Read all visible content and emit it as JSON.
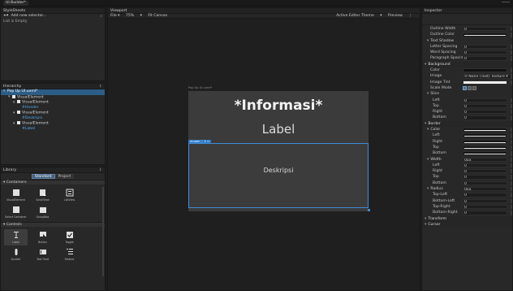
{
  "titlebar": {
    "doc_tab": "UI Builder*"
  },
  "stylesheets": {
    "title": "StyleSheets",
    "add_label": "Add new selector...",
    "empty_text": "List is Empty"
  },
  "hierarchy": {
    "title": "Hierarchy",
    "rows": [
      {
        "label": "Pop Up UI.uxml*",
        "depth": 0,
        "selected": true
      },
      {
        "label": "VisualElement",
        "depth": 1
      },
      {
        "label": "VisualElement",
        "depth": 2
      },
      {
        "label": "#Header",
        "depth": 3,
        "sub": true
      },
      {
        "label": "VisualElement",
        "depth": 2
      },
      {
        "label": "#Deskripsi",
        "depth": 3,
        "sub": true
      },
      {
        "label": "VisualElement",
        "depth": 2
      },
      {
        "label": "#Label",
        "depth": 3,
        "sub": true
      }
    ]
  },
  "library": {
    "title": "Library",
    "tabs": [
      "Standard",
      "Project"
    ],
    "active_tab": "Standard",
    "sections": [
      {
        "title": "Containers",
        "items": [
          {
            "label": "VisualElement",
            "icon": "square-icon"
          },
          {
            "label": "ScrollView",
            "icon": "scrollview-icon"
          },
          {
            "label": "ListView",
            "icon": "listview-icon"
          },
          {
            "label": "Select Container",
            "icon": "select-icon"
          },
          {
            "label": "GroupBox",
            "icon": "groupbox-icon"
          }
        ]
      },
      {
        "title": "Controls",
        "items": [
          {
            "label": "Label",
            "icon": "text-cursor-icon",
            "selected": true
          },
          {
            "label": "Button",
            "icon": "cursor-icon"
          },
          {
            "label": "Toggle",
            "icon": "checkbox-icon"
          },
          {
            "label": "Scroller",
            "icon": "scroller-icon"
          },
          {
            "label": "Text Field",
            "icon": "textfield-icon"
          },
          {
            "label": "Foldout",
            "icon": "foldout-icon"
          }
        ]
      }
    ]
  },
  "viewport": {
    "title": "Viewport",
    "toolbar_left": [
      "File ▾",
      "75%",
      "▾",
      "Fit Canvas"
    ],
    "toolbar_right": [
      "Active Editor Theme",
      "▾",
      "Preview",
      "⋮"
    ],
    "canvas_title": "Pop Up UI.uxml*",
    "popup": {
      "title": "*Informasi*",
      "label": "Label",
      "description": "Deskripsi",
      "selection_tag": "#Label"
    },
    "accent": "#3f8bd6"
  },
  "inspector": {
    "title": "Inspector",
    "rows": [
      {
        "kind": "field",
        "label": "Outline Width",
        "value": "0"
      },
      {
        "kind": "field",
        "label": "Outline Color",
        "value": "",
        "style": "line"
      },
      {
        "kind": "sub",
        "label": "Text Shadow"
      },
      {
        "kind": "field",
        "label": "Letter Spacing",
        "value": "0"
      },
      {
        "kind": "field",
        "label": "Word Spacing",
        "value": "0"
      },
      {
        "kind": "field",
        "label": "Paragraph Spacing",
        "value": "0"
      },
      {
        "kind": "section",
        "label": "Background"
      },
      {
        "kind": "field",
        "label": "Color",
        "value": "",
        "style": "dark"
      },
      {
        "kind": "field",
        "label": "Image",
        "value": "⊙ None (Text) Texture ▾"
      },
      {
        "kind": "field",
        "label": "Image Tint",
        "value": "",
        "style": "white"
      },
      {
        "kind": "icons",
        "label": "Scale Mode"
      },
      {
        "kind": "sub",
        "label": "Slice"
      },
      {
        "kind": "field2",
        "label": "Left",
        "value": "0"
      },
      {
        "kind": "field2",
        "label": "Top",
        "value": "0"
      },
      {
        "kind": "field2",
        "label": "Right",
        "value": "0"
      },
      {
        "kind": "field2",
        "label": "Bottom",
        "value": "0"
      },
      {
        "kind": "section",
        "label": "Border"
      },
      {
        "kind": "sub",
        "label": "Color",
        "value": "",
        "style": "line"
      },
      {
        "kind": "field2",
        "label": "Left",
        "value": "",
        "style": "line"
      },
      {
        "kind": "field2",
        "label": "Right",
        "value": "",
        "style": "line"
      },
      {
        "kind": "field2",
        "label": "Top",
        "value": "",
        "style": "line"
      },
      {
        "kind": "field2",
        "label": "Bottom",
        "value": "",
        "style": "line"
      },
      {
        "kind": "sub",
        "label": "Width",
        "value": "0px"
      },
      {
        "kind": "field2",
        "label": "Left",
        "value": "0"
      },
      {
        "kind": "field2",
        "label": "Right",
        "value": "0"
      },
      {
        "kind": "field2",
        "label": "Top",
        "value": "0"
      },
      {
        "kind": "field2",
        "label": "Bottom",
        "value": "0"
      },
      {
        "kind": "sub",
        "label": "Radius",
        "value": "0px"
      },
      {
        "kind": "field2",
        "label": "Top-Left",
        "value": "0"
      },
      {
        "kind": "field2",
        "label": "Bottom-Left",
        "value": "0"
      },
      {
        "kind": "field2",
        "label": "Top-Right",
        "value": "0"
      },
      {
        "kind": "field2",
        "label": "Bottom-Right",
        "value": "0"
      },
      {
        "kind": "section",
        "label": "Transform"
      },
      {
        "kind": "section",
        "label": "Cursor"
      }
    ]
  }
}
